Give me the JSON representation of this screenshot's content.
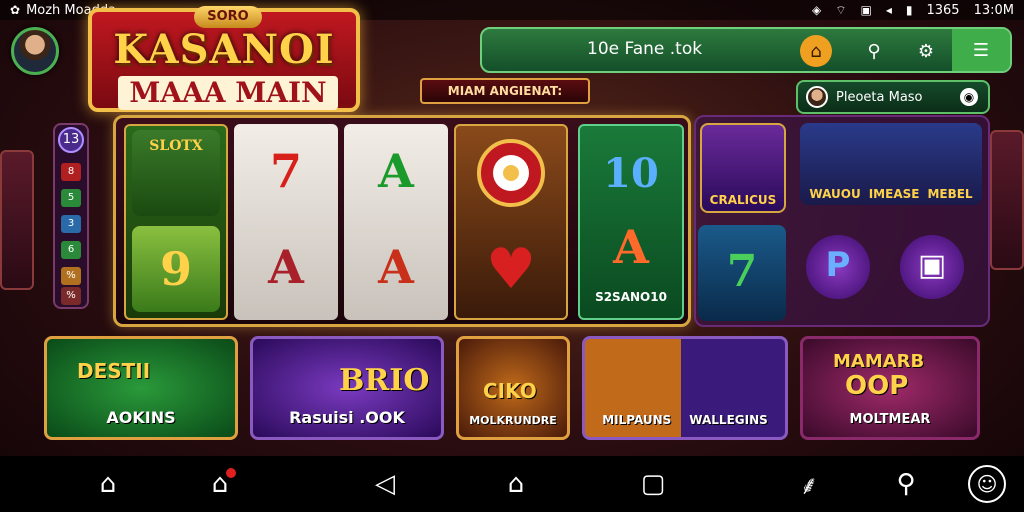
{
  "status": {
    "app_name": "Mozh Moadda",
    "battery": "1365",
    "time": "13:0M"
  },
  "logo": {
    "top": "SORO",
    "line1": "KASANOI",
    "line2": "MAAA MAIN"
  },
  "search": {
    "text": "10e Fane .tok"
  },
  "subbanner": "MIAM ANGIENAT:",
  "profile_chip": {
    "label": "Pleoeta Maso"
  },
  "left_strip": {
    "level": "13",
    "items": [
      "8",
      "5",
      "3",
      "6",
      "%",
      "%"
    ]
  },
  "reels": {
    "r1": {
      "top_label": "SLOTX",
      "bottom": "9"
    },
    "r2": {
      "top": "7",
      "bottom": "A"
    },
    "r3": {
      "top": "A",
      "bottom": "A"
    },
    "r4": {
      "top": "",
      "bottom": "♥"
    },
    "r5": {
      "top": "10",
      "bottom": "A",
      "caption": "S2SANO10"
    }
  },
  "right_panel": {
    "tile1": "CRALICUS",
    "tile2": "WAUOU",
    "tile2b": "IMEASE",
    "tile2c": "MEBEL",
    "tile3": "7",
    "tile4": "P"
  },
  "games": [
    {
      "title": "DESTII",
      "label": "AOKINS"
    },
    {
      "title": "BRIO",
      "label": "Rasuisi .OOK"
    },
    {
      "title": "CIKO",
      "label": "MOLKRUNDRE"
    },
    {
      "title": "",
      "label": "MILPAUNS"
    },
    {
      "title": "",
      "label": "WALLEGINS"
    },
    {
      "title": "MAMARB",
      "title2": "OOP",
      "label": "MOLTMEAR"
    }
  ],
  "colors": {
    "accent_green": "#3fae4a",
    "accent_gold": "#e0a040",
    "brand_red": "#c01820"
  },
  "icons": {
    "nav": [
      "home-icon",
      "home-badge-icon",
      "back-icon",
      "home-button-icon",
      "recents-icon",
      "gesture-icon",
      "search-icon",
      "face-icon"
    ]
  }
}
